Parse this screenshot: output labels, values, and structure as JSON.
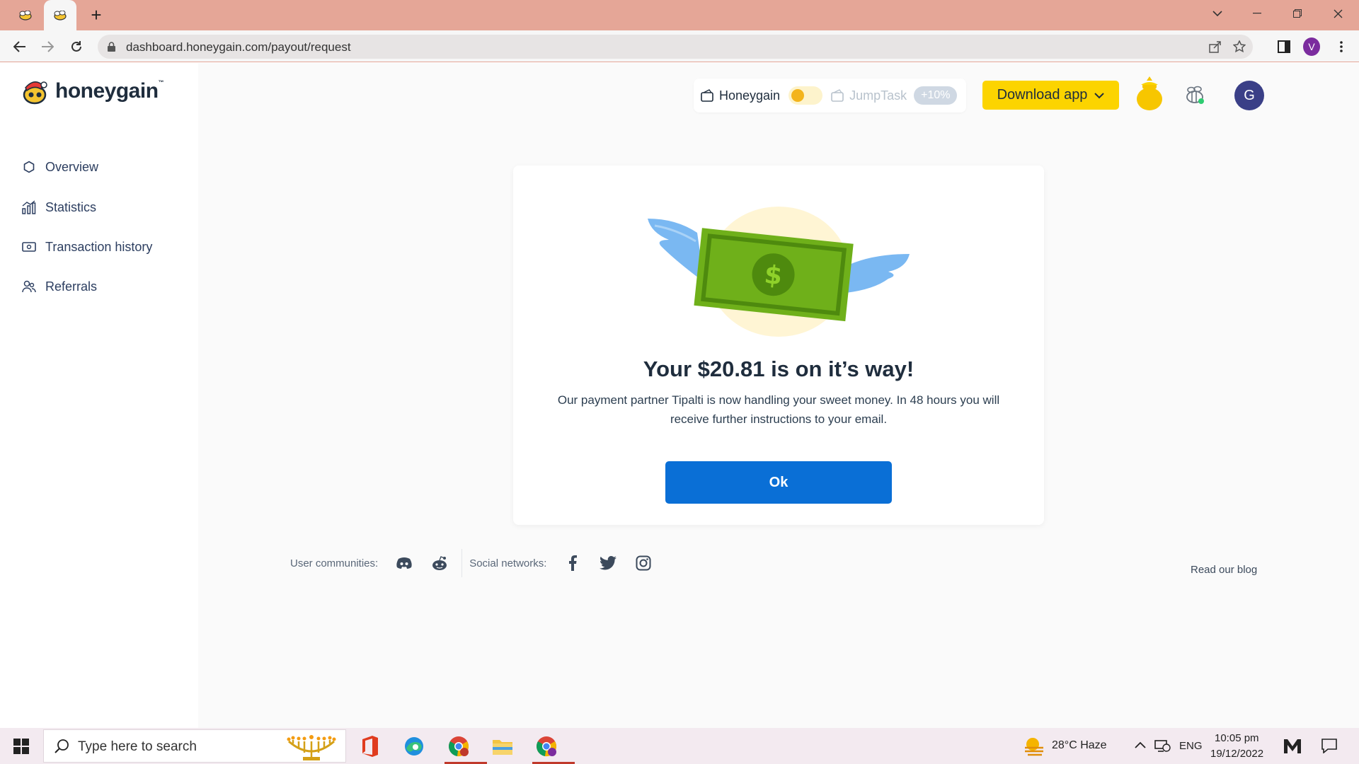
{
  "browser": {
    "url": "dashboard.honeygain.com/payout/request",
    "profile_initial": "V"
  },
  "brand": {
    "name": "honeygain",
    "tm": "™"
  },
  "sidebar": {
    "items": [
      {
        "label": "Overview",
        "icon": "hexagon-icon"
      },
      {
        "label": "Statistics",
        "icon": "bar-chart-icon"
      },
      {
        "label": "Transaction history",
        "icon": "wallet-icon"
      },
      {
        "label": "Referrals",
        "icon": "users-icon"
      }
    ]
  },
  "header": {
    "honeygain_label": "Honeygain",
    "jumptask_label": "JumpTask",
    "bonus_label": "+10%",
    "download_label": "Download app",
    "avatar_initial": "G"
  },
  "card": {
    "title": "Your $20.81 is on it’s way!",
    "description": "Our payment partner Tipalti is now handling your sweet money. In 48 hours you will receive further instructions to your email.",
    "ok_label": "Ok"
  },
  "footer": {
    "communities_label": "User communities:",
    "social_label": "Social networks:",
    "blog_label": "Read our blog"
  },
  "taskbar": {
    "search_placeholder": "Type here to search",
    "weather": "28°C  Haze",
    "lang": "ENG",
    "time": "10:05 pm",
    "date": "19/12/2022"
  },
  "colors": {
    "accent_yellow": "#fcd400",
    "ok_blue": "#0a6fd6",
    "tab_bar": "#e5a697"
  }
}
